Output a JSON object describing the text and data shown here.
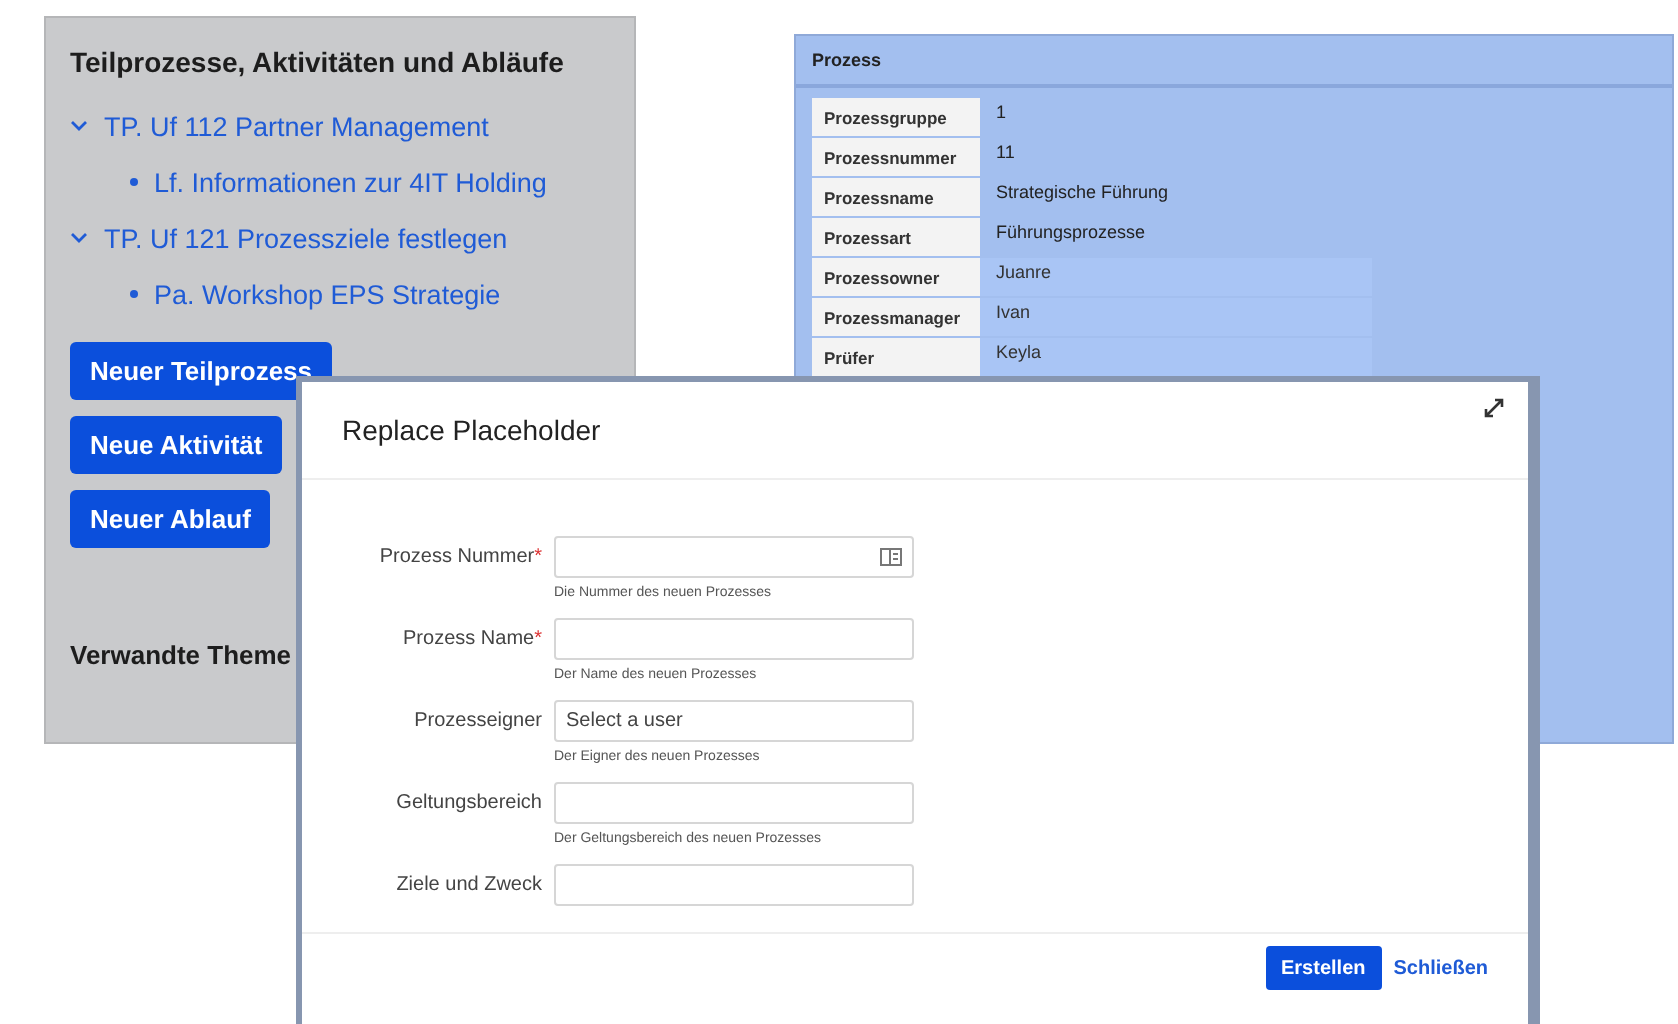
{
  "left_panel": {
    "title": "Teilprozesse, Aktivitäten und Abläufe",
    "tree": [
      {
        "label": "TP. Uf 112 Partner Management",
        "expanded": true,
        "children": [
          {
            "label": "Lf. Informationen zur 4IT Holding"
          }
        ]
      },
      {
        "label": "TP. Uf 121 Prozessziele festlegen",
        "expanded": true,
        "children": [
          {
            "label": "Pa. Workshop EPS Strategie"
          }
        ]
      }
    ],
    "buttons": [
      "Neuer Teilprozess",
      "Neue Aktivität",
      "Neuer Ablauf"
    ],
    "section_title": "Verwandte Theme"
  },
  "process_panel": {
    "title": "Prozess",
    "rows": [
      {
        "label": "Prozessgruppe",
        "value": "1"
      },
      {
        "label": "Prozessnummer",
        "value": "11"
      },
      {
        "label": "Prozessname",
        "value": "Strategische Führung"
      },
      {
        "label": "Prozessart",
        "value": "Führungsprozesse"
      },
      {
        "label": "Prozessowner",
        "value": "Juanre"
      },
      {
        "label": "Prozessmanager",
        "value": "Ivan"
      },
      {
        "label": "Prüfer",
        "value": "Keyla"
      }
    ]
  },
  "dialog": {
    "title": "Replace Placeholder",
    "fields": [
      {
        "label": "Prozess Nummer",
        "required_mark": "*",
        "kind": "number",
        "hint": "Die Nummer des neuen Prozesses"
      },
      {
        "label": "Prozess Name",
        "required_mark": "*",
        "kind": "text",
        "hint": "Der Name des neuen Prozesses"
      },
      {
        "label": "Prozesseigner",
        "kind": "user",
        "placeholder": "Select a user",
        "hint": "Der Eigner des neuen Prozesses"
      },
      {
        "label": "Geltungsbereich",
        "kind": "text",
        "hint": "Der Geltungsbereich des neuen Prozesses"
      },
      {
        "label": "Ziele und Zweck",
        "kind": "text"
      }
    ],
    "primary_button": "Erstellen",
    "close_link": "Schließen"
  }
}
